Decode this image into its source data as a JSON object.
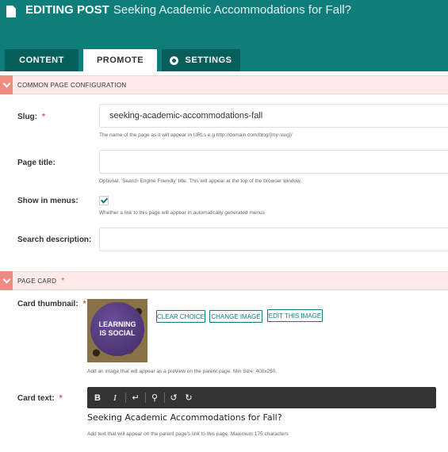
{
  "header": {
    "title_prefix": "EDITING POST",
    "title": "Seeking Academic Accommodations for Fall?",
    "brand_color": "#0f7e7a",
    "icon": "document-icon"
  },
  "tabs": [
    {
      "label": "CONTENT",
      "active": false
    },
    {
      "label": "PROMOTE",
      "active": true
    },
    {
      "label": "SETTINGS",
      "active": false,
      "icon": "gear-icon"
    }
  ],
  "sections": {
    "common": {
      "title": "COMMON PAGE CONFIGURATION"
    },
    "card": {
      "title": "PAGE CARD",
      "required": "*"
    }
  },
  "fields": {
    "slug": {
      "label": "Slug:",
      "required": "*",
      "value": "seeking-academic-accommodations-fall",
      "help": "The name of the page as it will appear in URLs e.g http://domain.com/blog/[my-slug]/"
    },
    "page_title": {
      "label": "Page title:",
      "value": "",
      "help": "Optional. 'Search Engine Friendly' title. This will appear at the top of the browser window."
    },
    "show_in_menus": {
      "label": "Show in menus:",
      "checked": true,
      "help": "Whether a link to this page will appear in automatically generated menus"
    },
    "search_description": {
      "label": "Search description:",
      "value": ""
    },
    "card_thumbnail": {
      "label": "Card thumbnail:",
      "required": "*",
      "image_text_line1": "LEARNING",
      "image_text_line2": "IS SOCIAL",
      "buttons": {
        "clear": "CLEAR CHOICE",
        "change": "CHANGE IMAGE",
        "edit": "EDIT THIS IMAGE"
      },
      "help": "Add an image that will appear as a preview on the parent page. Min Size: 400x250."
    },
    "card_text": {
      "label": "Card text:",
      "required": "*",
      "toolbar": {
        "bold": "B",
        "italic": "I",
        "enter": "↵",
        "link": "⚲",
        "undo": "↺",
        "redo": "↻"
      },
      "value": "Seeking Academic Accommodations for Fall?",
      "help": "Add text that will appear on the parent page's link to this page. Maximum 175 characters"
    }
  }
}
